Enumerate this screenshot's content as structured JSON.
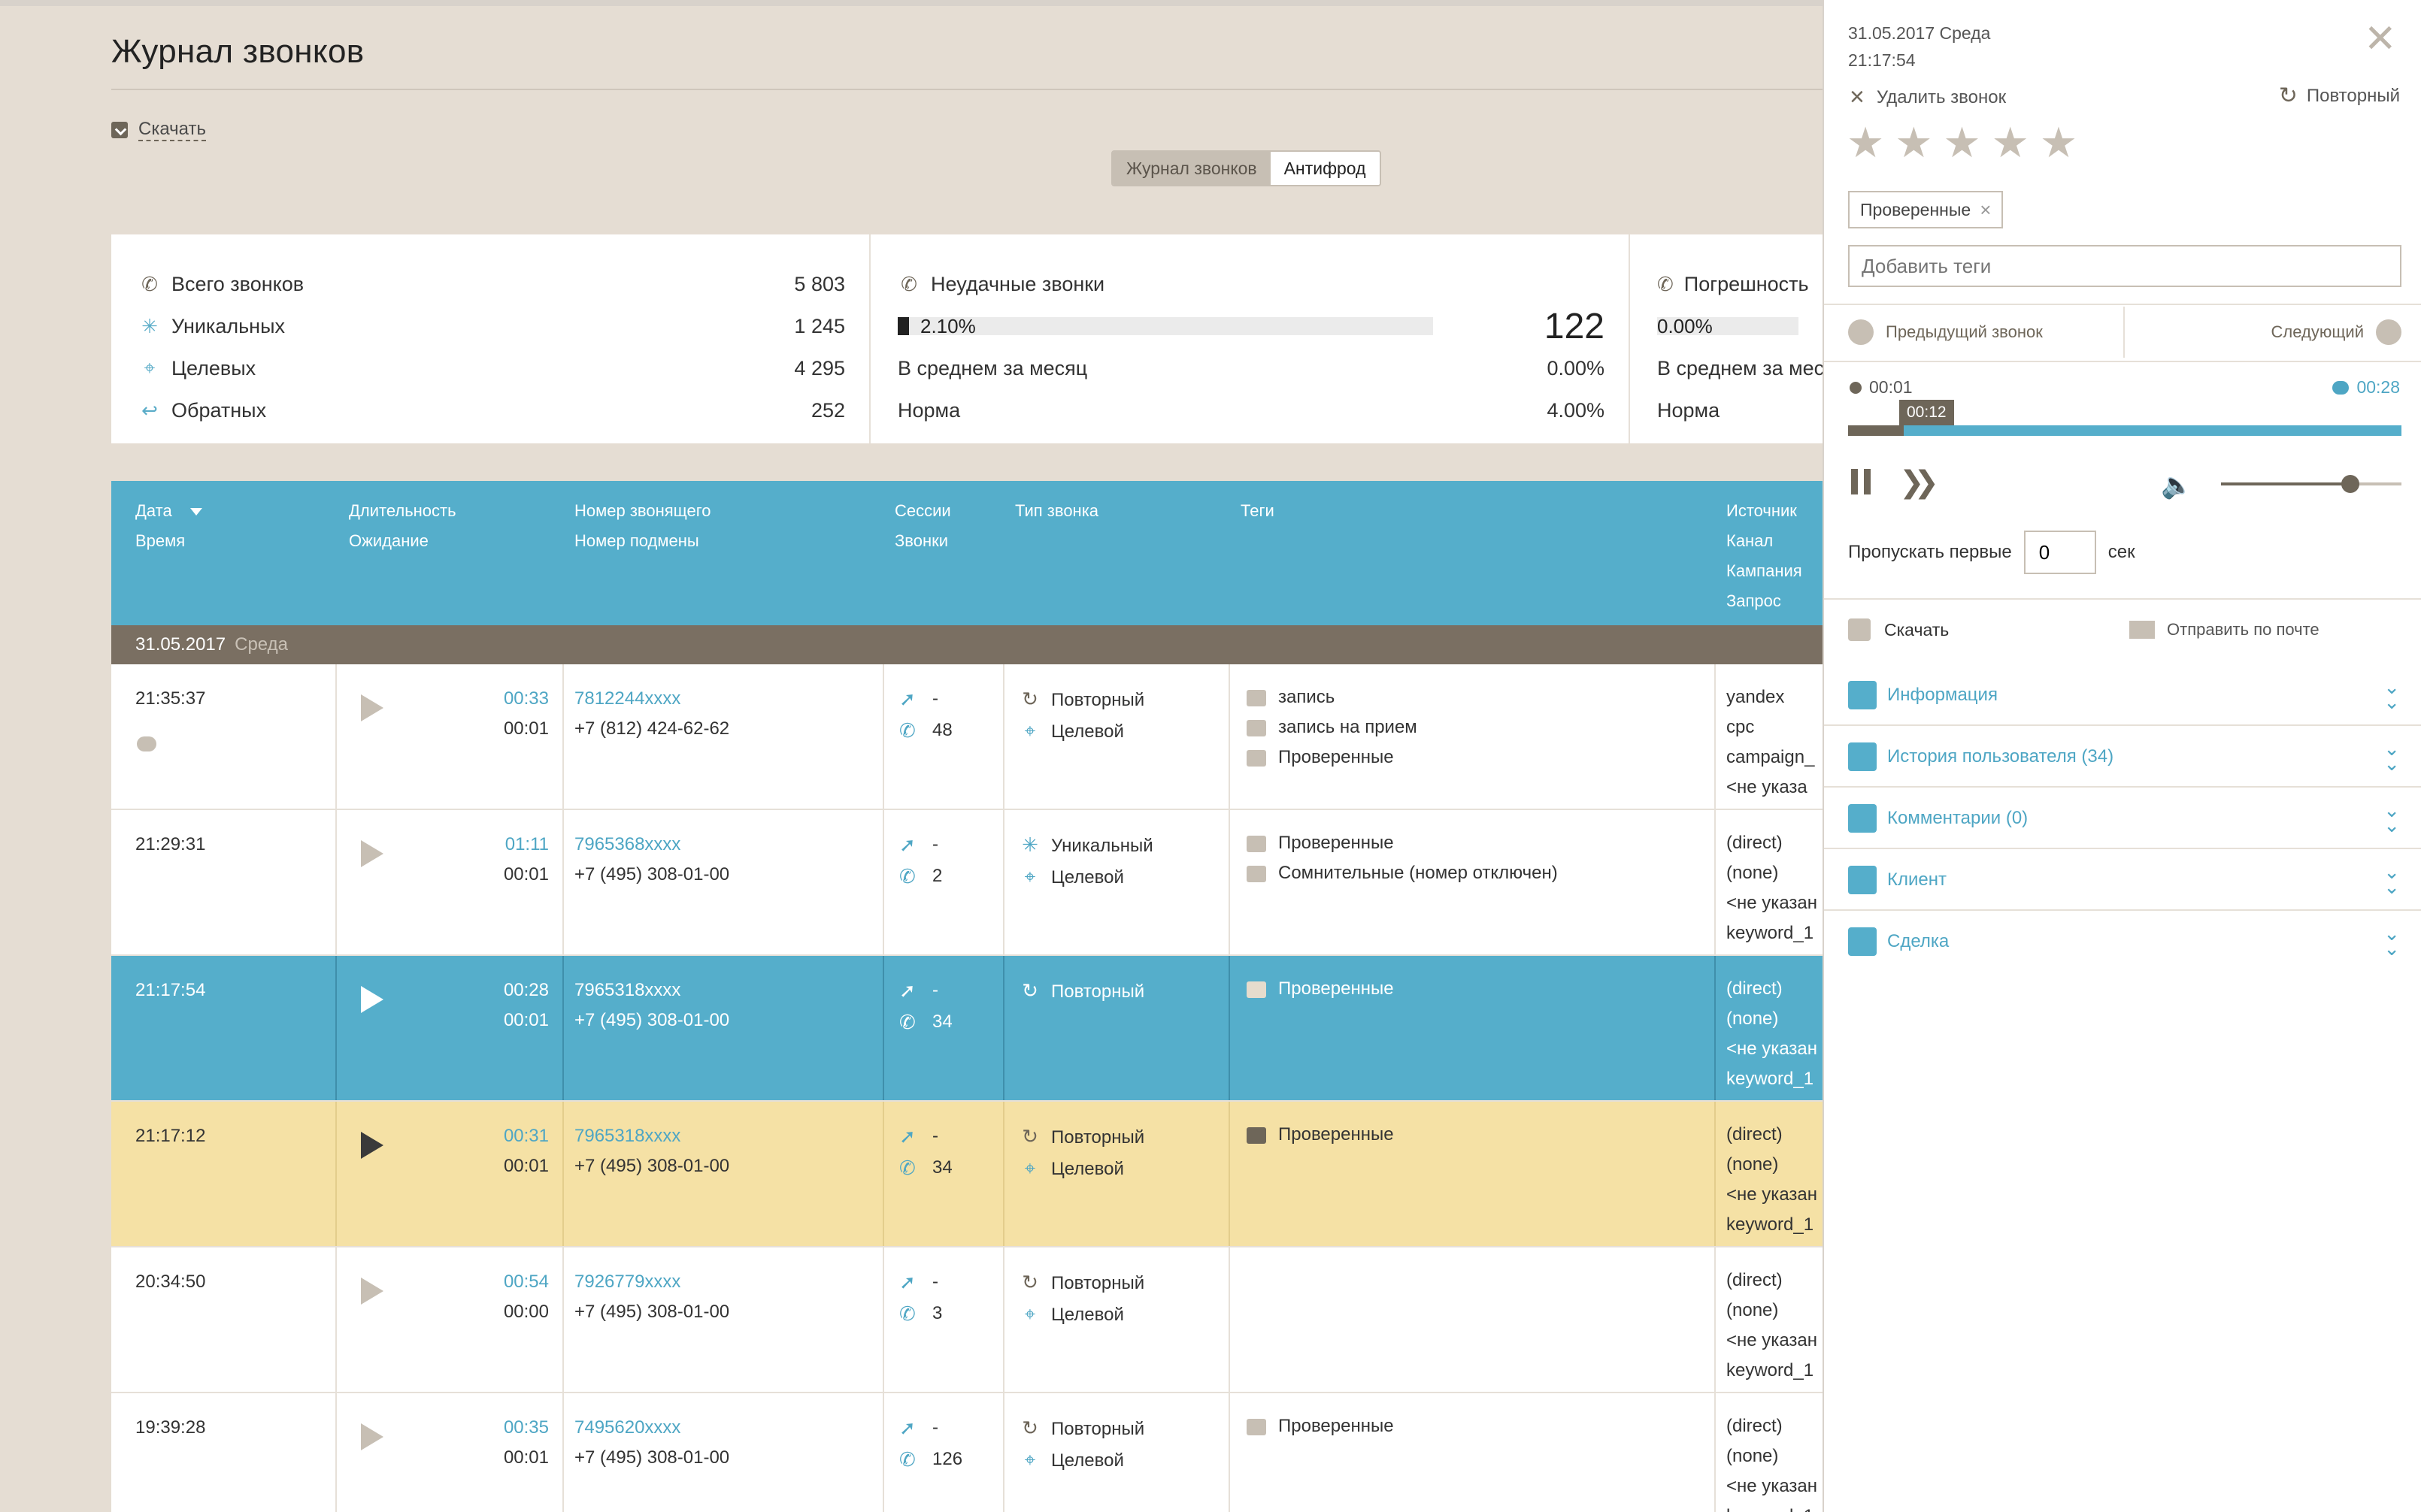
{
  "page": {
    "title": "Журнал звонков",
    "download": "Скачать",
    "tabs": [
      "Журнал звонков",
      "Антифрод"
    ]
  },
  "stats": {
    "total": {
      "label": "Всего звонков",
      "value": "5 803"
    },
    "unique": {
      "label": "Уникальных",
      "value": "1 245"
    },
    "target": {
      "label": "Целевых",
      "value": "4 295"
    },
    "callback": {
      "label": "Обратных",
      "value": "252"
    },
    "failed": {
      "title": "Неудачные звонки",
      "pct": "2.10%",
      "pct_value": 0.021,
      "count": "122",
      "avg_label": "В среднем за месяц",
      "avg_value": "0.00%",
      "norm_label": "Норма",
      "norm_value": "4.00%"
    },
    "errors": {
      "title": "Погрешность",
      "pct": "0.00%",
      "avg_label": "В среднем за мес",
      "norm_label": "Норма"
    }
  },
  "table": {
    "headers": {
      "date": "Дата",
      "time": "Время",
      "duration": "Длительность",
      "wait": "Ожидание",
      "caller": "Номер звонящего",
      "subst": "Номер подмены",
      "sessions": "Сессии",
      "calls": "Звонки",
      "type": "Тип звонка",
      "tags": "Теги",
      "source": "Источник",
      "channel": "Канал",
      "campaign": "Кампания",
      "query": "Запрос"
    },
    "group": {
      "date": "31.05.2017",
      "weekday": "Среда"
    },
    "rows": [
      {
        "time": "21:35:37",
        "dur": "00:33",
        "wait": "00:01",
        "caller": "7812244xxxx",
        "subst": "+7 (812) 424-62-62",
        "sess": "-",
        "calls": "48",
        "type1": "Повторный",
        "type2": "Целевой",
        "tags": [
          "запись",
          "запись на прием",
          "Проверенные"
        ],
        "src": [
          "yandex",
          "cpc",
          "campaign_",
          "<не указа"
        ]
      },
      {
        "time": "21:29:31",
        "dur": "01:11",
        "wait": "00:01",
        "caller": "7965368xxxx",
        "subst": "+7 (495) 308-01-00",
        "sess": "-",
        "calls": "2",
        "type1": "Уникальный",
        "type2": "Целевой",
        "tags": [
          "Проверенные",
          "Сомнительные (номер отключен)"
        ],
        "src": [
          "(direct)",
          "(none)",
          "<не указан",
          "keyword_1"
        ]
      },
      {
        "time": "21:17:54",
        "dur": "00:28",
        "wait": "00:01",
        "caller": "7965318xxxx",
        "subst": "+7 (495) 308-01-00",
        "sess": "-",
        "calls": "34",
        "type1": "Повторный",
        "type2": "",
        "tags": [
          "Проверенные"
        ],
        "src": [
          "(direct)",
          "(none)",
          "<не указан",
          "keyword_1"
        ]
      },
      {
        "time": "21:17:12",
        "dur": "00:31",
        "wait": "00:01",
        "caller": "7965318xxxx",
        "subst": "+7 (495) 308-01-00",
        "sess": "-",
        "calls": "34",
        "type1": "Повторный",
        "type2": "Целевой",
        "tags": [
          "Проверенные"
        ],
        "src": [
          "(direct)",
          "(none)",
          "<не указан",
          "keyword_1"
        ]
      },
      {
        "time": "20:34:50",
        "dur": "00:54",
        "wait": "00:00",
        "caller": "7926779xxxx",
        "subst": "+7 (495) 308-01-00",
        "sess": "-",
        "calls": "3",
        "type1": "Повторный",
        "type2": "Целевой",
        "tags": [],
        "src": [
          "(direct)",
          "(none)",
          "<не указан",
          "keyword_1"
        ]
      },
      {
        "time": "19:39:28",
        "dur": "00:35",
        "wait": "00:01",
        "caller": "7495620xxxx",
        "subst": "+7 (495) 308-01-00",
        "sess": "-",
        "calls": "126",
        "type1": "Повторный",
        "type2": "Целевой",
        "tags": [
          "Проверенные"
        ],
        "src": [
          "(direct)",
          "(none)",
          "<не указан",
          "keyword_1"
        ]
      }
    ]
  },
  "panel": {
    "date": "31.05.2017 Среда",
    "time": "21:17:54",
    "delete": "Удалить звонок",
    "repeat": "Повторный",
    "rating": 0,
    "tag_chip": "Проверенные",
    "tag_placeholder": "Добавить теги",
    "prev": "Предыдущий звонок",
    "next": "Следующий",
    "current_time": "00:01",
    "total_time": "00:28",
    "tooltip": "00:12",
    "progress": 0.1,
    "volume": 0.7,
    "skip_label": "Пропускать первые",
    "skip_value": "0",
    "skip_unit": "сек",
    "download": "Скачать",
    "email": "Отправить по почте",
    "sections": [
      "Информация",
      "История пользователя (34)",
      "Комментарии (0)",
      "Клиент",
      "Сделка"
    ]
  },
  "colors": {
    "accent": "#55aecb",
    "brown": "#6e6659",
    "highlight": "#f5e1a5",
    "bg": "#e5ddd3"
  }
}
